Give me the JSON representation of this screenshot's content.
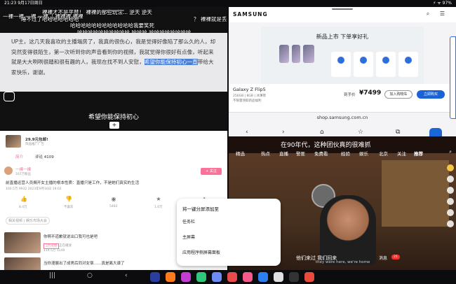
{
  "status_bar": {
    "time": "21:23 9月17日周日",
    "right": "⚡ ᯤ 97%"
  },
  "danmaku_pane": {
    "top_lines": [
      "裸裸才不是平替！ 裸裸的那些玩法... 逆天 逆天",
      "一裸一裸 一裸 一裸（ 裸裸裸 裸裸",
      "睡不过了哈哈哈哈哈哈哈",
      "？ 裸裸就是丢",
      "哈哈哈哈哈哈哈哈哈哈哈哈我要笑死",
      "哈哈哈哈哈哈哈哈哈哈 哈哈哈 哈哈哈哈哈哈哈哈",
      "哈哈哈哈哈哈 哈哈哈哈",
      "好的 好的 好好的"
    ],
    "comment_before": "UP主，这几天我喜欢的主播塌房了，我真的很伤心，我是觉得好像陷了那么久的人，却突然变得很陌生，第一次听到你的声音看到你的视频，我就觉得你很好有点像，听起来就是大大咧咧很踏和很有趣的人，我现在找不到人安慰，",
    "comment_highlight": "希望你能保持初心一直",
    "comment_after": "带给大家快乐，谢谢。",
    "subtitle": "希望你能保持初心"
  },
  "samsung_pane": {
    "logo": "SAMSUNG",
    "header_icons": "⌕ ☰",
    "banner_title": "新品上市 下单享好礼",
    "product_name": "Galaxy Z Flip5",
    "product_spec": "256GB | 8GB | 冰薄荷",
    "product_sub": "不限量领取新品福利",
    "price_label": "到手价",
    "price": "¥7499",
    "cart_button": "加入购物车",
    "buy_button": "立即购买",
    "url": "shop.samsung.com.cn",
    "nav_icons": [
      "‹",
      "›",
      "⌂",
      "☆",
      "⧉",
      "⋮"
    ]
  },
  "bilibili_pane": {
    "coupon": "29.9元包邮!",
    "coupon_sub": "饰品推广广告",
    "tabs": [
      "简介",
      "评论 4109"
    ],
    "author": "一裸一裸",
    "author_meta": "167万粉丝",
    "follow": "+ 关注",
    "video_title": "前直播运营人员揭开女主播的根本性质：直播只是工作，不是她们真实的生活",
    "video_stats": "100.5万  9932  2023年9月16日 19:02",
    "actions": [
      {
        "icon": "👍",
        "count": "8.4万"
      },
      {
        "icon": "👎",
        "count": "不喜欢"
      },
      {
        "icon": "◉",
        "count": "5483"
      },
      {
        "icon": "★",
        "count": "1.6万"
      },
      {
        "icon": "↗",
        "count": "1.7万"
      }
    ],
    "tag": "相关视频 | 娱乐市场大会",
    "rec1_title": "你啊不道歉就说出口我可也是吧",
    "rec1_badge": "3万点赞",
    "rec1_meta": "正在播放",
    "rec1_stats": "114.5万  1149",
    "rec2_title": "当你漫展出了成男后同对女宿……真是离大谱了"
  },
  "video_pane": {
    "title": "在90年代，这种团伙真的很难抓",
    "tabs": [
      "精选",
      "热点",
      "直播",
      "警匪",
      "免费看",
      "经验",
      "娱乐",
      "北京",
      "关注",
      "推荐"
    ],
    "active_tab": "推荐",
    "caption": "他们来过 我们回来",
    "caption_sub": "they were here, we're home",
    "tag": "21",
    "bottom_label": "消息"
  },
  "popup_menu": {
    "title": "将一键分屏添加至",
    "items": [
      "任务栏",
      "主屏幕",
      "应用程序侧屏幕面板"
    ]
  },
  "taskbar": {
    "nav": [
      "|||",
      "○",
      "‹"
    ],
    "apps": [
      {
        "color": "#2a3f9d"
      },
      {
        "color": "#ff7a1a"
      },
      {
        "color": "#c33dd0"
      },
      {
        "color": "#30c77a"
      },
      {
        "color": "#6d8cf5"
      },
      {
        "color": "#e84b4b"
      },
      {
        "color": "#f55a8a"
      },
      {
        "color": "#2d7ff0"
      },
      {
        "color": "#e0e0e0"
      },
      {
        "color": "#333333"
      },
      {
        "color": "#e84b3c"
      }
    ]
  }
}
